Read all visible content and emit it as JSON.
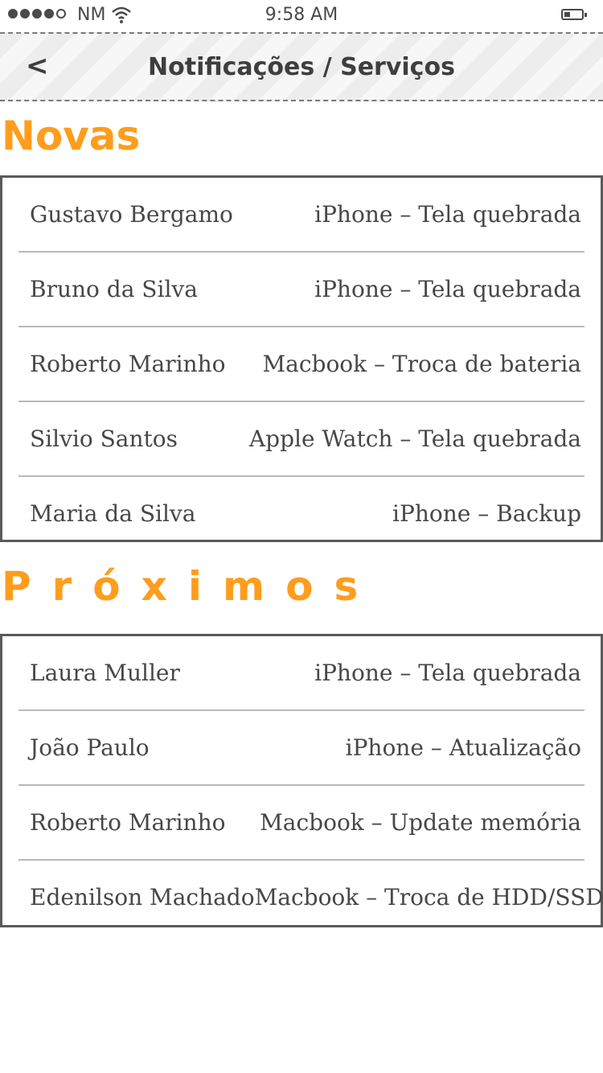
{
  "status_bar": {
    "carrier": "NM",
    "time": "9:58 AM",
    "signal_icon": "signal-dots-icon",
    "wifi_icon": "wifi-icon",
    "battery_icon": "battery-icon"
  },
  "nav": {
    "back_icon": "back-chevron-icon",
    "back_glyph": "<",
    "title": "Notificações / Serviços"
  },
  "sections": {
    "novas": {
      "title": "Novas",
      "items": [
        {
          "name": "Gustavo Bergamo",
          "service": "iPhone – Tela quebrada"
        },
        {
          "name": "Bruno da Silva",
          "service": "iPhone – Tela quebrada"
        },
        {
          "name": "Roberto Marinho",
          "service": "Macbook – Troca de bateria"
        },
        {
          "name": "Silvio Santos",
          "service": "Apple Watch – Tela quebrada"
        },
        {
          "name": "Maria da Silva",
          "service": "iPhone – Backup"
        }
      ]
    },
    "proximos": {
      "title": "Próximos",
      "items": [
        {
          "name": "Laura Muller",
          "service": "iPhone – Tela quebrada"
        },
        {
          "name": "João Paulo",
          "service": "iPhone – Atualização"
        },
        {
          "name": "Roberto Marinho",
          "service": "Macbook – Update memória"
        },
        {
          "name": "Edenilson Machado",
          "service": "Macbook – Troca de HDD/SSD"
        }
      ]
    }
  },
  "colors": {
    "accent": "#ff9d1c",
    "text": "#4a4a4a",
    "divider": "#b9b9b9"
  }
}
